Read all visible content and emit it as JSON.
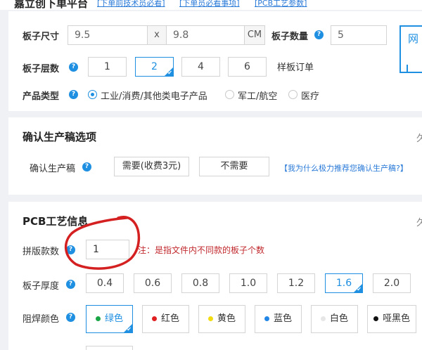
{
  "header": {
    "title": "嘉立创下单平台",
    "links": [
      "[下单前技术员必看]",
      "[下单员必看事项]",
      "[PCB工艺参数]"
    ]
  },
  "size": {
    "label": "板子尺寸",
    "width": "9.5",
    "sep": "x",
    "height": "9.8",
    "unit": "CM"
  },
  "quantity": {
    "label": "板子数量",
    "value": "5"
  },
  "right_box": {
    "text": "网"
  },
  "layers": {
    "label": "板子层数",
    "options": [
      "1",
      "2",
      "4",
      "6"
    ],
    "selected": "2",
    "sample": "样板订单"
  },
  "product": {
    "label": "产品类型",
    "options": [
      "工业/消费/其他类电子产品",
      "军工/航空",
      "医疗"
    ],
    "selected": "工业/消费/其他类电子产品"
  },
  "confirm": {
    "title": "确认生产稿选项",
    "label": "确认生产稿",
    "options": [
      "需要(收费3元)",
      "不需要"
    ],
    "link": "【我为什么极力推荐您确认生产稿?】",
    "fold": "久"
  },
  "pcb": {
    "title": "PCB工艺信息",
    "fold": "久",
    "panel_label": "拼版款数",
    "panel_value": "1",
    "panel_note": "注：是指文件内不同款的板子个数",
    "thickness_label": "板子厚度",
    "thickness_options": [
      "0.4",
      "0.6",
      "0.8",
      "1.0",
      "1.2",
      "1.6",
      "2.0"
    ],
    "thickness_selected": "1.6",
    "color_label": "阻焊颜色",
    "colors": [
      {
        "label": "绿色",
        "dot": "#1aa546"
      },
      {
        "label": "红色",
        "dot": "#e02020"
      },
      {
        "label": "黄色",
        "dot": "#f2dc12"
      },
      {
        "label": "蓝色",
        "dot": "#2286e6"
      },
      {
        "label": "白色",
        "dot": "#e6e6e6"
      },
      {
        "label": "哑黑色",
        "dot": "#111111"
      }
    ],
    "color_selected": "绿色"
  },
  "annotation": {
    "color": "#d42020"
  }
}
